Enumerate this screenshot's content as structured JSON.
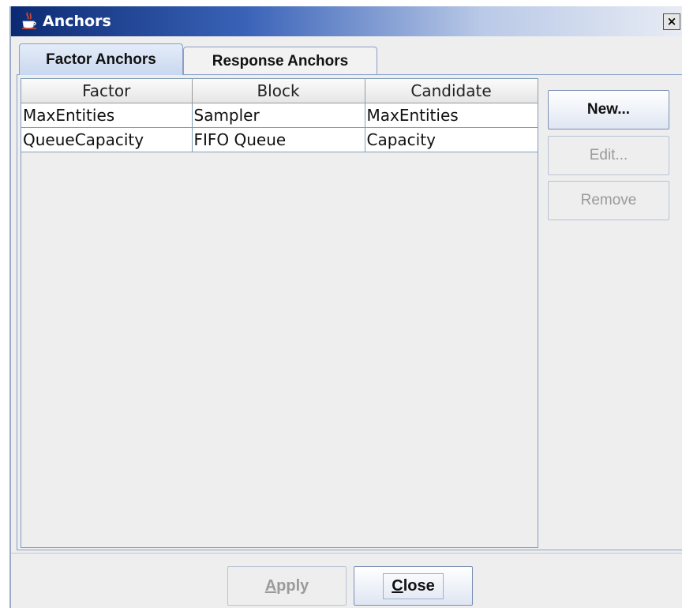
{
  "window": {
    "title": "Anchors",
    "close_label": "×"
  },
  "tabs": [
    {
      "label": "Factor Anchors",
      "active": true
    },
    {
      "label": "Response Anchors",
      "active": false
    }
  ],
  "table": {
    "columns": [
      "Factor",
      "Block",
      "Candidate"
    ],
    "rows": [
      [
        "MaxEntities",
        "Sampler",
        "MaxEntities"
      ],
      [
        "QueueCapacity",
        "FIFO Queue",
        "Capacity"
      ]
    ]
  },
  "side_buttons": {
    "new_label": "New...",
    "edit_label": "Edit...",
    "remove_label": "Remove"
  },
  "bottom_buttons": {
    "apply_mnemonic": "A",
    "apply_rest": "pply",
    "close_mnemonic": "C",
    "close_rest": "lose"
  }
}
